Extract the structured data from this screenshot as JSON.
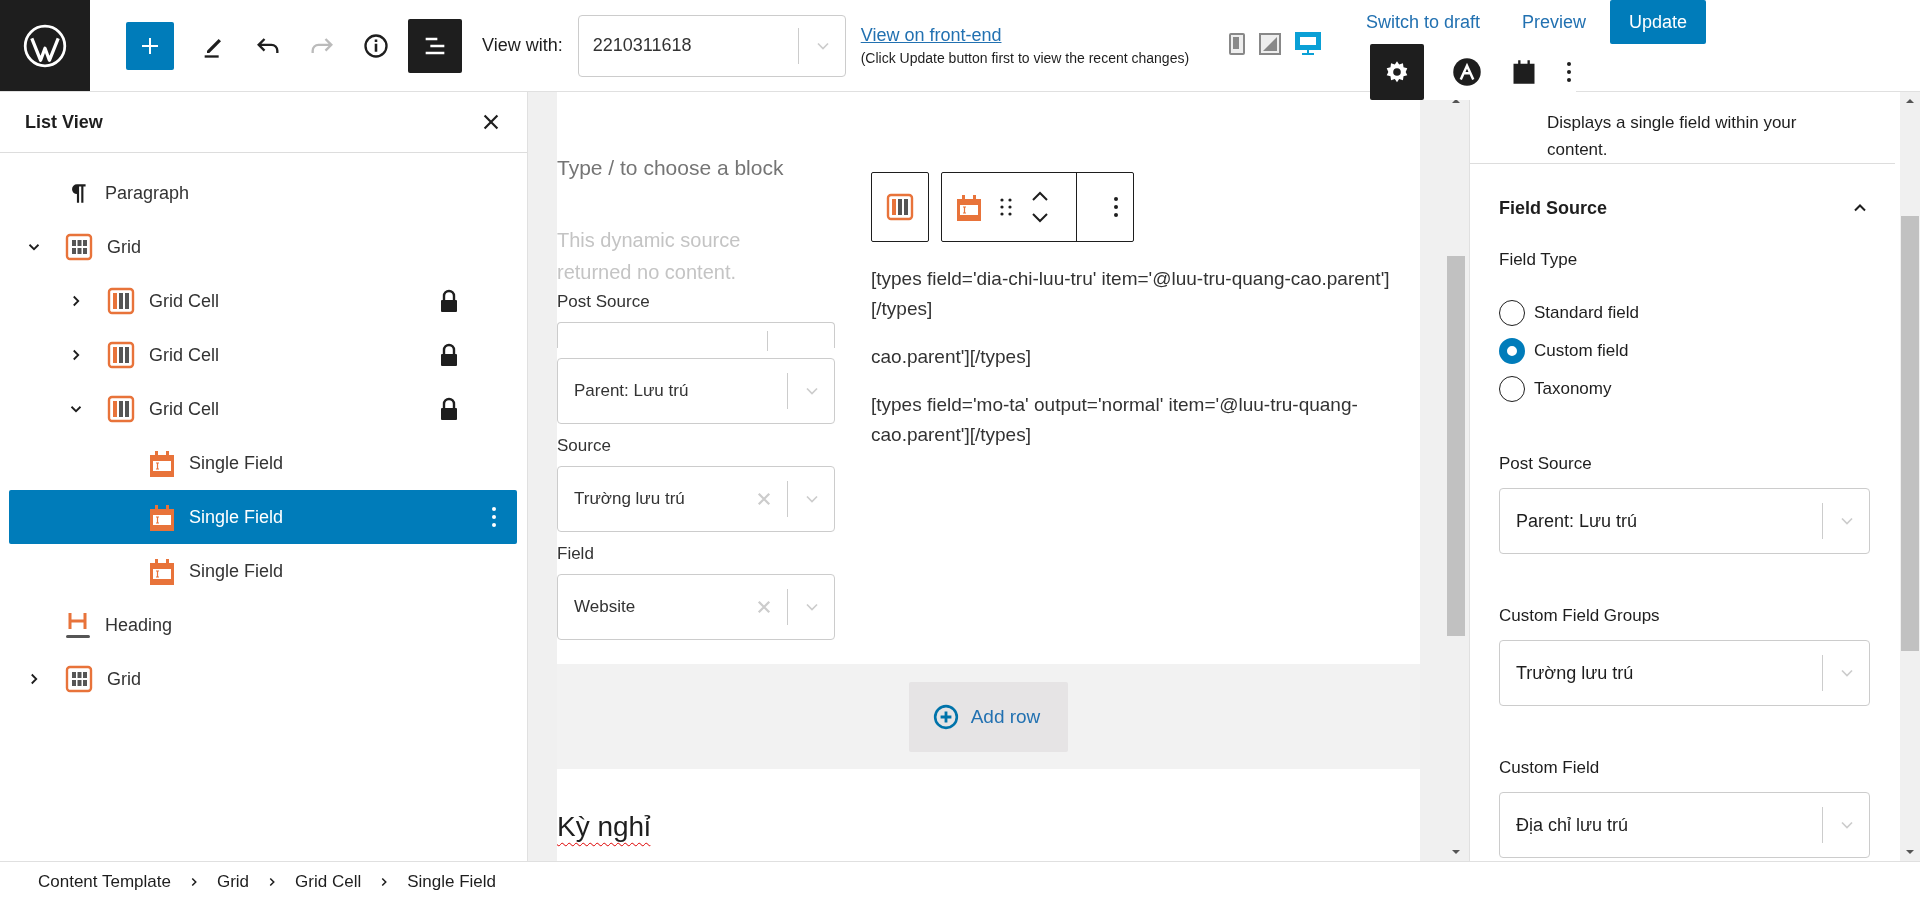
{
  "toolbar": {
    "view_with_label": "View with:",
    "view_with_value": "2210311618",
    "front_end_link": "View on front-end",
    "front_end_note": "(Click Update button first to view the recent changes)",
    "devices": [
      {
        "kind": "mobile",
        "selected": false
      },
      {
        "kind": "tablet",
        "selected": false
      },
      {
        "kind": "desktop",
        "selected": true
      }
    ],
    "switch_to_draft": "Switch to draft",
    "preview": "Preview",
    "update": "Update"
  },
  "list_view": {
    "title": "List View",
    "items": [
      {
        "label": "Paragraph",
        "kind": "paragraph",
        "selected": false
      },
      {
        "label": "Grid",
        "kind": "grid",
        "selected": false,
        "expanded": true,
        "children": [
          {
            "label": "Grid Cell",
            "kind": "grid-cell",
            "selected": false,
            "expanded": false,
            "locked": true
          },
          {
            "label": "Grid Cell",
            "kind": "grid-cell",
            "selected": false,
            "expanded": false,
            "locked": true
          },
          {
            "label": "Grid Cell",
            "kind": "grid-cell",
            "selected": false,
            "expanded": true,
            "locked": true,
            "children": [
              {
                "label": "Single Field",
                "kind": "single-field",
                "selected": false
              },
              {
                "label": "Single Field",
                "kind": "single-field",
                "selected": true
              },
              {
                "label": "Single Field",
                "kind": "single-field",
                "selected": false
              }
            ]
          }
        ]
      },
      {
        "label": "Heading",
        "kind": "heading",
        "selected": false
      },
      {
        "label": "Grid",
        "kind": "grid",
        "selected": false,
        "expanded": false
      }
    ]
  },
  "canvas": {
    "placeholder": "Type / to choose a block",
    "notice": "This dynamic source returned no content.",
    "fields": [
      {
        "label": "Post Source",
        "kind": "empty"
      },
      {
        "kind": "select",
        "value": "Parent: Lưu trú",
        "clearable": false
      },
      {
        "label": "Source",
        "kind": "select",
        "value": "Trường lưu trú",
        "clearable": true
      },
      {
        "label": "Field",
        "kind": "select",
        "value": "Website",
        "clearable": true
      }
    ],
    "shortcodes": [
      "[types field='dia-chi-luu-tru' item='@luu-tru-quang-cao.parent'][/types]",
      "cao.parent'][/types]",
      "[types field='mo-ta' output='normal' item='@luu-tru-quang-cao.parent'][/types]"
    ],
    "add_row": "Add row",
    "heading": "Kỳ nghỉ"
  },
  "settings": {
    "description": "Displays a single field within your content.",
    "section": {
      "title": "Field Source",
      "expanded": true
    },
    "field_type": {
      "label": "Field Type",
      "options": [
        {
          "label": "Standard field",
          "selected": false
        },
        {
          "label": "Custom field",
          "selected": true
        },
        {
          "label": "Taxonomy",
          "selected": false
        }
      ]
    },
    "selects": [
      {
        "label": "Post Source",
        "value": "Parent: Lưu trú"
      },
      {
        "label": "Custom Field Groups",
        "value": "Trường lưu trú"
      },
      {
        "label": "Custom Field",
        "value": "Địa chỉ lưu trú"
      }
    ]
  },
  "breadcrumb": [
    "Content Template",
    "Grid",
    "Grid Cell",
    "Single Field"
  ]
}
